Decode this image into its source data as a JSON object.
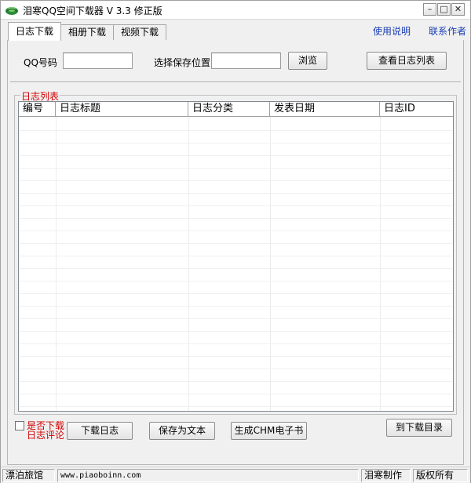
{
  "window": {
    "title": "泪寒QQ空间下载器 V 3.3 修正版",
    "min_label": "–",
    "max_label": "□",
    "close_label": "✕"
  },
  "tabs": [
    {
      "label": "日志下载",
      "active": true
    },
    {
      "label": "相册下载",
      "active": false
    },
    {
      "label": "视频下载",
      "active": false
    }
  ],
  "links": {
    "help": "使用说明",
    "contact": "联系作者"
  },
  "form": {
    "qq_label": "QQ号码",
    "qq_value": "",
    "save_location_label": "选择保存位置",
    "save_location_value": "",
    "browse_button": "浏览",
    "view_list_button": "查看日志列表"
  },
  "log_list": {
    "group_title": "日志列表",
    "columns": [
      "编号",
      "日志标题",
      "日志分类",
      "发表日期",
      "日志ID"
    ],
    "rows": []
  },
  "bottom": {
    "download_checkbox_checked": false,
    "download_comments_line1": "是否下载",
    "download_comments_line2": "日志评论",
    "download_log_button": "下载日志",
    "save_as_text_button": "保存为文本",
    "generate_chm_button": "生成CHM电子书",
    "open_download_dir_button": "到下载目录"
  },
  "statusbar": {
    "name": "漂泊旅馆",
    "url": "www.piaoboinn.com",
    "author": "泪寒制作",
    "copyright": "版权所有"
  },
  "colors": {
    "accent_red": "#d40000",
    "link_blue": "#1a3eb3"
  }
}
